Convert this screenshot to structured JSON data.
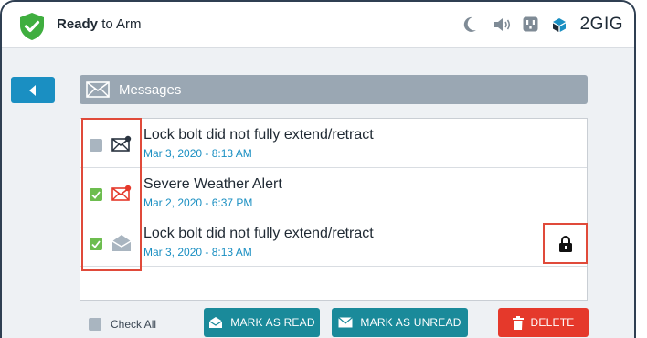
{
  "header": {
    "status_bold": "Ready",
    "status_rest": " to Arm",
    "brand": "2GIG",
    "icons": [
      "moon-icon",
      "speaker-icon",
      "outlet-icon",
      "screen-icon"
    ]
  },
  "nav": {
    "back_icon": "back-arrow-icon"
  },
  "messages": {
    "title": "Messages",
    "items": [
      {
        "title": "Lock bolt did not fully extend/retract",
        "date": "Mar 3, 2020 - 8:13 AM",
        "checked": false,
        "status": "unread"
      },
      {
        "title": "Severe Weather Alert",
        "date": "Mar 2, 2020 - 6:37 PM",
        "checked": true,
        "status": "unread-alert"
      },
      {
        "title": "Lock bolt did not fully extend/retract",
        "date": "Mar 3, 2020 - 8:13 AM",
        "checked": true,
        "status": "read",
        "locked": true
      }
    ]
  },
  "footer": {
    "check_all": "Check All",
    "mark_read": "MARK AS READ",
    "mark_unread": "MARK AS UNREAD",
    "delete": "DELETE"
  },
  "colors": {
    "accent": "#1a8fc2",
    "teal_button": "#1a8a9a",
    "delete_red": "#e5392b",
    "highlight": "#e04a3a",
    "check_green": "#6dbd4f",
    "shield_green": "#3fae3f"
  }
}
